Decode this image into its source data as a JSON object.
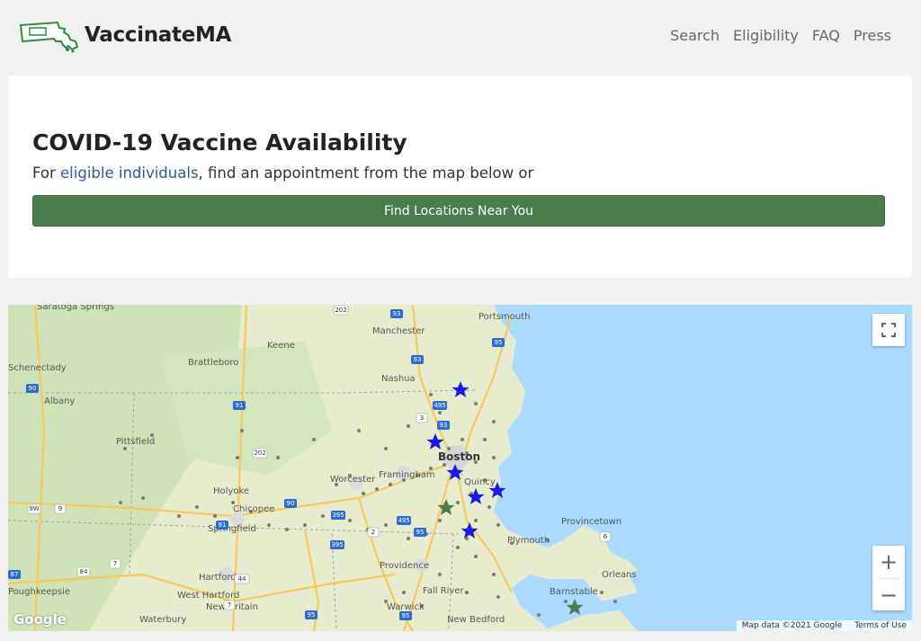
{
  "header": {
    "brand": "VaccinateMA",
    "nav": [
      "Search",
      "Eligibility",
      "FAQ",
      "Press"
    ]
  },
  "card": {
    "title": "COVID-19 Vaccine Availability",
    "subtitle_prefix": "For ",
    "subtitle_link": "eligible individuals",
    "subtitle_suffix": ", find an appointment from the map below or",
    "button": "Find Locations Near You"
  },
  "map": {
    "places": [
      "Saratoga Springs",
      "Manchester",
      "Portsmouth",
      "Keene",
      "Schenectady",
      "Brattleboro",
      "Nashua",
      "Albany",
      "Pittsfield",
      "Boston",
      "Worcester",
      "Framingham",
      "Quincy",
      "Holyoke",
      "Chicopee",
      "Springfield",
      "Provincetown",
      "Plymouth",
      "Providence",
      "Hartford",
      "West Hartford",
      "New Britain",
      "Poughkeepsie",
      "Orleans",
      "Barnstable",
      "Fall River",
      "Warwick",
      "New Bedford",
      "Waterbury"
    ],
    "highways": [
      "202",
      "93",
      "95",
      "93",
      "91",
      "3",
      "495",
      "202",
      "90",
      "90",
      "395",
      "495",
      "95",
      "91",
      "395",
      "93",
      "6",
      "84",
      "9W",
      "9",
      "7",
      "44",
      "87",
      "7",
      "95",
      "95",
      "2"
    ],
    "google_logo": "Google",
    "attribution": "Map data ©2021 Google",
    "terms": "Terms of Use",
    "zoom_in": "+",
    "zoom_out": "−",
    "colors": {
      "available_star": "#1a1ae6",
      "other_star": "#4a7c4e",
      "water": "#aadaff",
      "land": "#e8eccf"
    }
  }
}
